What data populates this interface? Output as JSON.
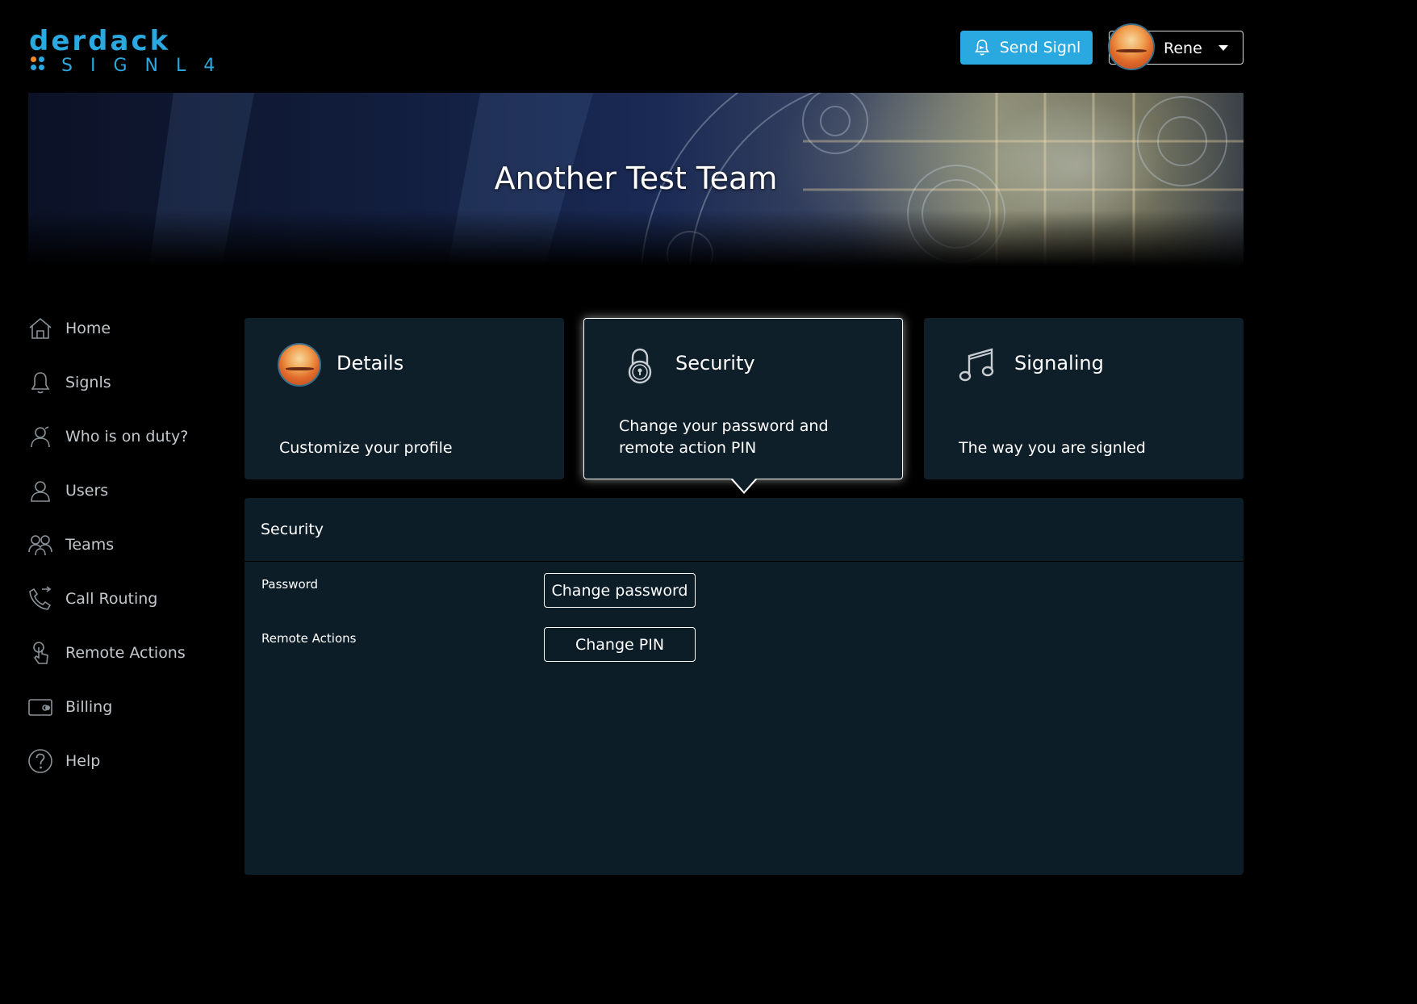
{
  "logo": {
    "top_text": "derdack",
    "bottom_text": "SIGNL4"
  },
  "header": {
    "send_button_label": "Send Signl",
    "user_name": "Rene"
  },
  "banner": {
    "title": "Another Test Team"
  },
  "sidebar": {
    "items": [
      {
        "label": "Home",
        "icon": "home-icon"
      },
      {
        "label": "Signls",
        "icon": "bell-icon"
      },
      {
        "label": "Who is on duty?",
        "icon": "person-duty-icon"
      },
      {
        "label": "Users",
        "icon": "user-icon"
      },
      {
        "label": "Teams",
        "icon": "team-icon"
      },
      {
        "label": "Call Routing",
        "icon": "phone-icon"
      },
      {
        "label": "Remote Actions",
        "icon": "touch-icon"
      },
      {
        "label": "Billing",
        "icon": "card-icon"
      },
      {
        "label": "Help",
        "icon": "help-icon"
      }
    ]
  },
  "cards": [
    {
      "title": "Details",
      "description": "Customize your profile",
      "icon": "avatar"
    },
    {
      "title": "Security",
      "description_line1": "Change your password and",
      "description_line2": "remote action PIN",
      "icon": "lock-icon",
      "active": true
    },
    {
      "title": "Signaling",
      "description": "The way you are signled",
      "icon": "music-note-icon"
    }
  ],
  "panel": {
    "title": "Security",
    "rows": [
      {
        "label": "Password",
        "button": "Change password"
      },
      {
        "label": "Remote Actions",
        "button": "Change PIN"
      }
    ]
  },
  "colors": {
    "accent": "#29a9e0",
    "card_bg": "#0f1f29",
    "panel_bg": "#0c1d27",
    "background": "#000000"
  }
}
